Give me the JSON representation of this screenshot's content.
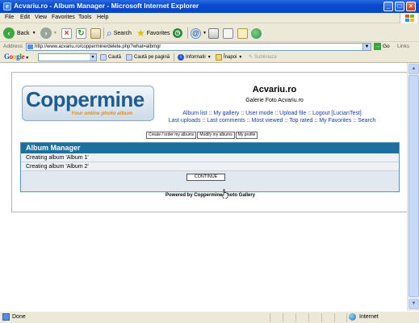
{
  "window": {
    "title": "Acvariu.ro - Album Manager - Microsoft Internet Explorer"
  },
  "menu": [
    "File",
    "Edit",
    "View",
    "Favorites",
    "Tools",
    "Help"
  ],
  "toolbar": {
    "back": "Back",
    "search": "Search",
    "favorites": "Favorites"
  },
  "address": {
    "label": "Address",
    "url": "http://www.acvariu.ro/coppermine/delete.php?what=albmgr",
    "go": "Go",
    "links": "Links"
  },
  "googlebar": {
    "logo": "Google",
    "cauta": "Caută",
    "cauta_pagina": "Caută pe pagină",
    "informatii": "Informatii",
    "inapoi": "Înapoi",
    "subliniaza": "Subliniaza"
  },
  "site": {
    "logo_word": "Coppermine",
    "logo_tagline": "Your online photo album",
    "title": "Acvariu.ro",
    "description": "Galerie Foto Acvariu.ro",
    "links_line1": [
      "Album list",
      "My gallery",
      "User mode",
      "Upload file",
      "Logout [LucianTest]"
    ],
    "links_line2": [
      "Last uploads",
      "Last comments",
      "Most viewed",
      "Top rated",
      "My Favorites",
      "Search"
    ],
    "separator": "::"
  },
  "admin_buttons": [
    "Create / order my albums",
    "Modify my albums",
    "My profile"
  ],
  "album_manager": {
    "header": "Album Manager",
    "rows": [
      "Creating album 'Album 1'",
      "Creating album 'Album 2'"
    ],
    "continue": "CONTINUE"
  },
  "footer": {
    "powered": "Powered by Coppermine Photo Gallery"
  },
  "status": {
    "left": "Done",
    "zone": "Internet"
  },
  "colors": {
    "titlebar": "#0a4ad0",
    "table_header": "#1e6f9b",
    "link": "#1a3fa0",
    "logo_text": "#1f5c8f",
    "logo_tagline": "#e08a20"
  }
}
